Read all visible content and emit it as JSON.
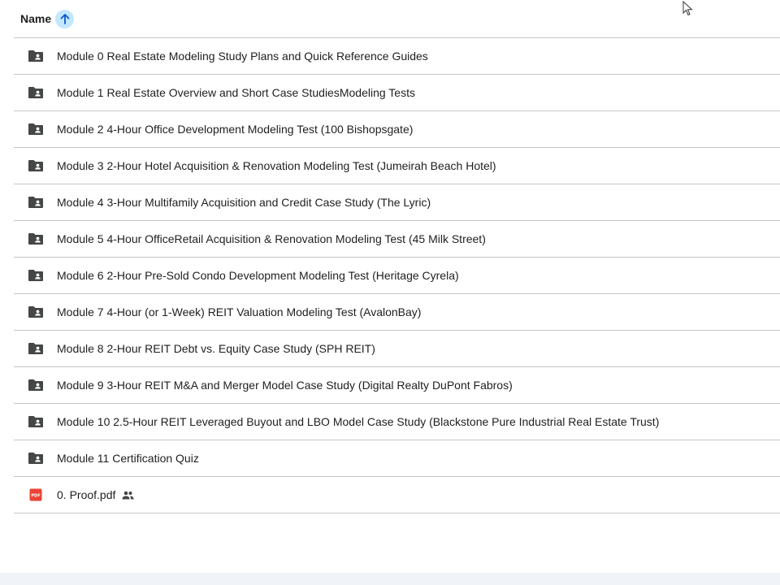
{
  "header": {
    "name_label": "Name",
    "sort_icon": "arrow-up-icon"
  },
  "rows": [
    {
      "icon": "shared-folder-icon",
      "label": "Module 0 Real Estate Modeling Study Plans and Quick Reference Guides"
    },
    {
      "icon": "shared-folder-icon",
      "label": "Module 1 Real Estate Overview and Short Case StudiesModeling Tests"
    },
    {
      "icon": "shared-folder-icon",
      "label": "Module 2 4-Hour Office Development Modeling Test (100 Bishopsgate)"
    },
    {
      "icon": "shared-folder-icon",
      "label": "Module 3 2-Hour Hotel Acquisition & Renovation Modeling Test (Jumeirah Beach Hotel)"
    },
    {
      "icon": "shared-folder-icon",
      "label": "Module 4 3-Hour Multifamily Acquisition and Credit Case Study (The Lyric)"
    },
    {
      "icon": "shared-folder-icon",
      "label": "Module 5 4-Hour OfficeRetail Acquisition & Renovation Modeling Test (45 Milk Street)"
    },
    {
      "icon": "shared-folder-icon",
      "label": "Module 6 2-Hour Pre-Sold Condo Development Modeling Test (Heritage Cyrela)"
    },
    {
      "icon": "shared-folder-icon",
      "label": "Module 7 4-Hour (or 1-Week) REIT Valuation Modeling Test (AvalonBay)"
    },
    {
      "icon": "shared-folder-icon",
      "label": "Module 8 2-Hour REIT Debt vs. Equity Case Study (SPH REIT)"
    },
    {
      "icon": "shared-folder-icon",
      "label": "Module 9 3-Hour REIT M&A and Merger Model Case Study (Digital Realty  DuPont Fabros)"
    },
    {
      "icon": "shared-folder-icon",
      "label": "Module 10 2.5-Hour REIT Leveraged Buyout and LBO Model Case Study (Blackstone  Pure Industrial Real Estate Trust)"
    },
    {
      "icon": "shared-folder-icon",
      "label": "Module 11 Certification Quiz"
    },
    {
      "icon": "pdf-icon",
      "label": "0. Proof.pdf",
      "shared": true
    }
  ],
  "colors": {
    "accent": "#c2e7ff",
    "folder": "#444746",
    "pdf": "#ea4335",
    "divider": "#c4c7c5"
  }
}
